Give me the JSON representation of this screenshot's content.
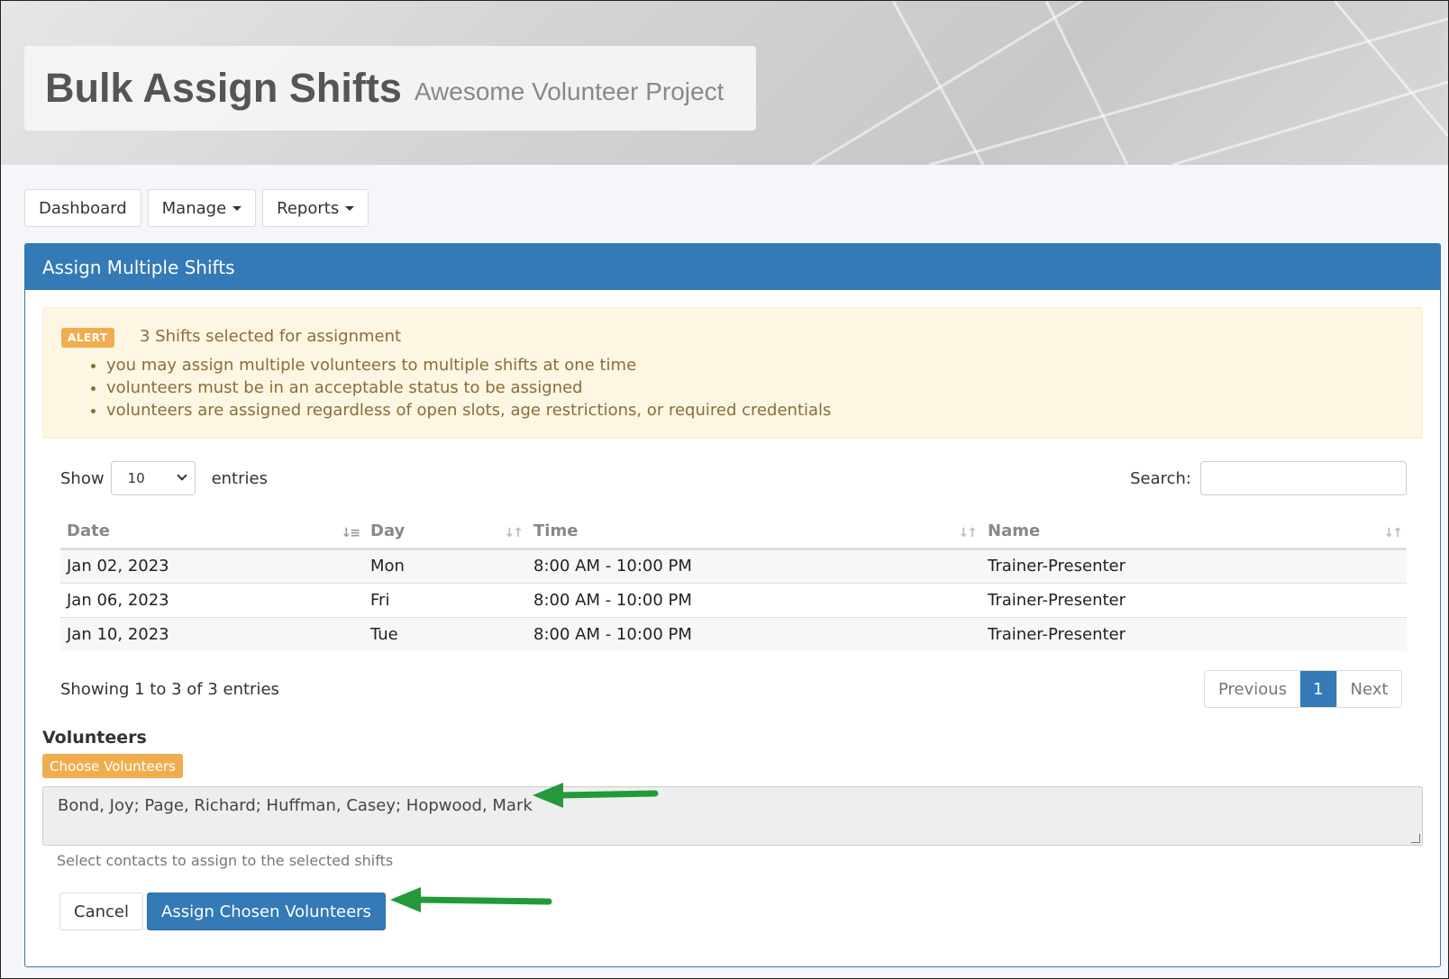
{
  "header": {
    "title": "Bulk Assign Shifts",
    "subtitle": "Awesome Volunteer Project"
  },
  "nav": {
    "dashboard": "Dashboard",
    "manage": "Manage",
    "reports": "Reports"
  },
  "panel": {
    "title": "Assign Multiple Shifts"
  },
  "alert": {
    "badge": "ALERT",
    "title": "3 Shifts selected for assignment",
    "items": [
      "you may assign multiple volunteers to multiple shifts at one time",
      "volunteers must be in an acceptable status to be assigned",
      "volunteers are assigned regardless of open slots, age restrictions, or required credentials"
    ]
  },
  "table_controls": {
    "show_label": "Show",
    "entries_value": "10",
    "entries_label": "entries",
    "search_label": "Search:",
    "search_value": ""
  },
  "table": {
    "columns": [
      "Date",
      "Day",
      "Time",
      "Name"
    ],
    "rows": [
      [
        "Jan 02, 2023",
        "Mon",
        "8:00 AM - 10:00 PM",
        "Trainer-Presenter"
      ],
      [
        "Jan 06, 2023",
        "Fri",
        "8:00 AM - 10:00 PM",
        "Trainer-Presenter"
      ],
      [
        "Jan 10, 2023",
        "Tue",
        "8:00 AM - 10:00 PM",
        "Trainer-Presenter"
      ]
    ]
  },
  "pagination": {
    "info": "Showing 1 to 3 of 3 entries",
    "previous": "Previous",
    "current": "1",
    "next": "Next"
  },
  "volunteers": {
    "label": "Volunteers",
    "choose_button": "Choose Volunteers",
    "selected": "Bond, Joy; Page, Richard; Huffman, Casey; Hopwood, Mark",
    "help": "Select contacts to assign to the selected shifts"
  },
  "actions": {
    "cancel": "Cancel",
    "assign": "Assign Chosen Volunteers"
  },
  "colors": {
    "primary": "#337ab7",
    "warning": "#f0ad4e",
    "alert_bg": "#fcf6e3",
    "annotation_arrow": "#229a3a"
  }
}
